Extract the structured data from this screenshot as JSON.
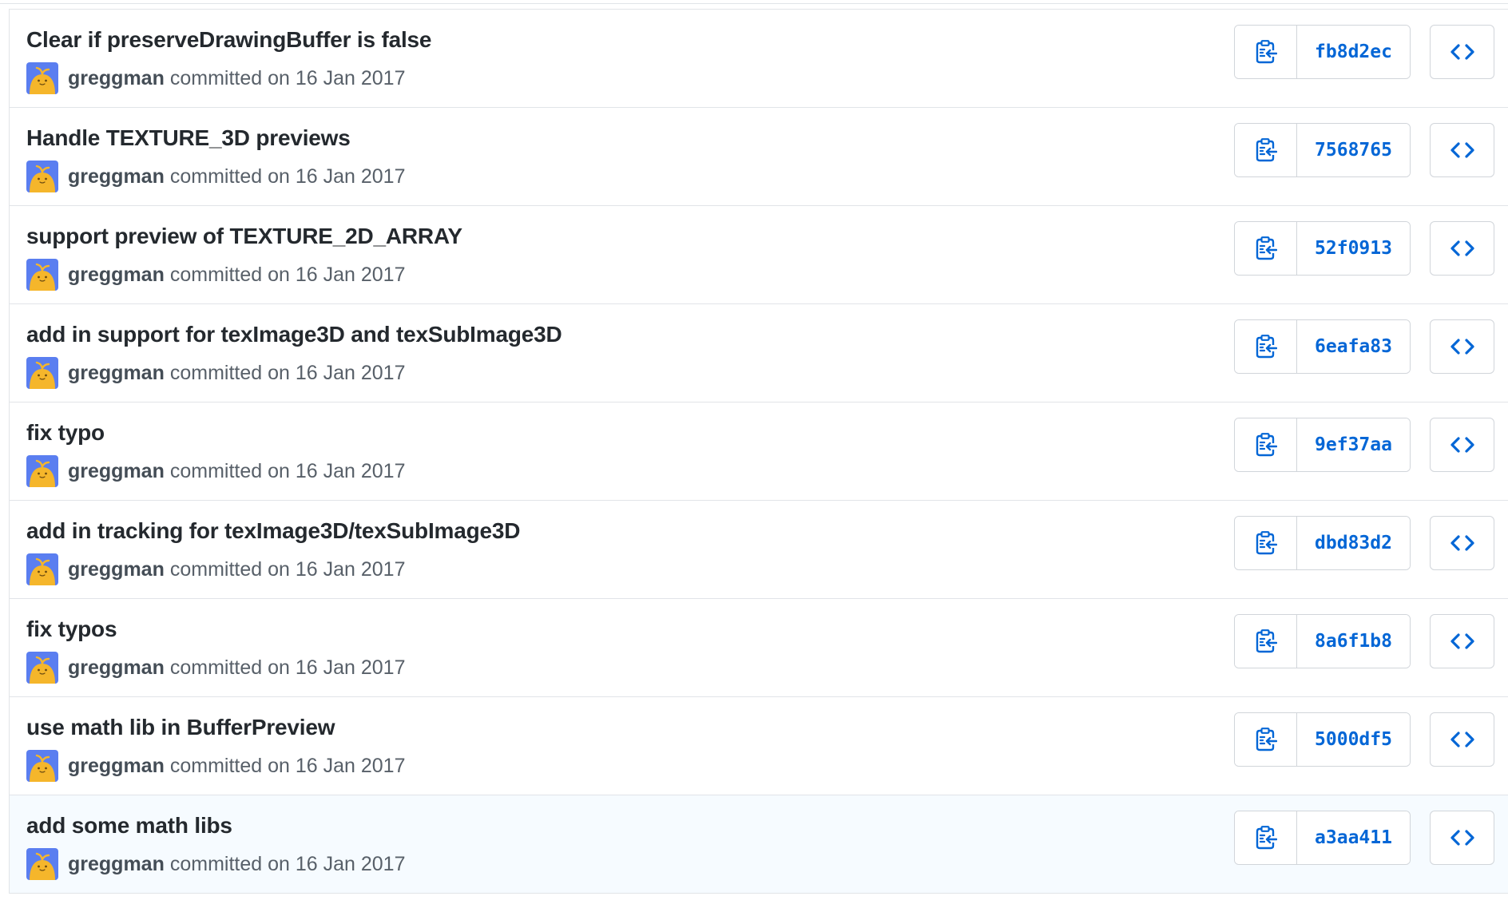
{
  "colors": {
    "title": "#24292e",
    "meta": "#586069",
    "link": "#0366d6",
    "border": "#d1d5da",
    "highlight_row": "#f6fbff",
    "avatar_bg": "#5a7ef0",
    "avatar_face": "#f5b62b"
  },
  "icons": {
    "copy": "clippy-icon",
    "browse": "code-icon"
  },
  "commits": [
    {
      "title": "Clear if preserveDrawingBuffer is false",
      "author": "greggman",
      "date_text": "committed on 16 Jan 2017",
      "sha": "fb8d2ec"
    },
    {
      "title": "Handle TEXTURE_3D previews",
      "author": "greggman",
      "date_text": "committed on 16 Jan 2017",
      "sha": "7568765"
    },
    {
      "title": "support preview of TEXTURE_2D_ARRAY",
      "author": "greggman",
      "date_text": "committed on 16 Jan 2017",
      "sha": "52f0913"
    },
    {
      "title": "add in support for texImage3D and texSubImage3D",
      "author": "greggman",
      "date_text": "committed on 16 Jan 2017",
      "sha": "6eafa83"
    },
    {
      "title": "fix typo",
      "author": "greggman",
      "date_text": "committed on 16 Jan 2017",
      "sha": "9ef37aa"
    },
    {
      "title": "add in tracking for texImage3D/texSubImage3D",
      "author": "greggman",
      "date_text": "committed on 16 Jan 2017",
      "sha": "dbd83d2"
    },
    {
      "title": "fix typos",
      "author": "greggman",
      "date_text": "committed on 16 Jan 2017",
      "sha": "8a6f1b8"
    },
    {
      "title": "use math lib in BufferPreview",
      "author": "greggman",
      "date_text": "committed on 16 Jan 2017",
      "sha": "5000df5"
    },
    {
      "title": "add some math libs",
      "author": "greggman",
      "date_text": "committed on 16 Jan 2017",
      "sha": "a3aa411",
      "highlighted": true
    }
  ]
}
